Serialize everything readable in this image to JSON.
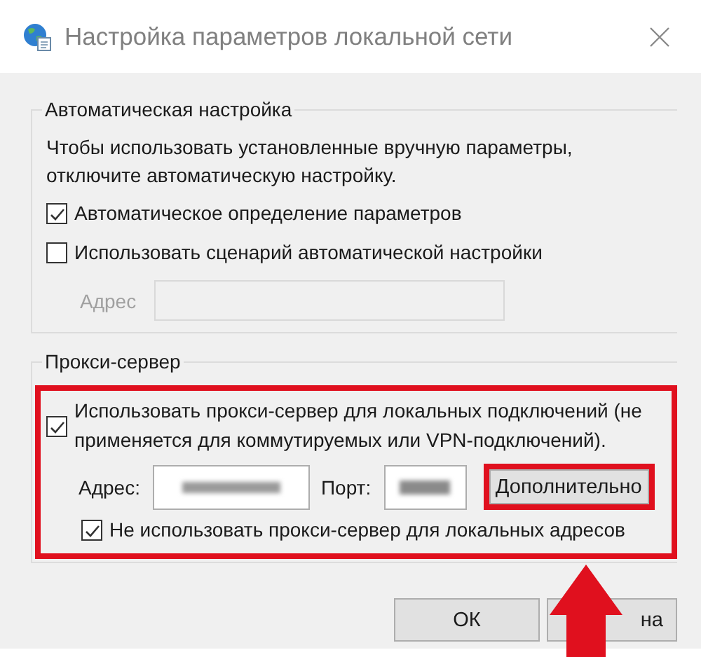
{
  "window": {
    "title": "Настройка параметров локальной сети"
  },
  "automatic": {
    "legend": "Автоматическая настройка",
    "hint": "Чтобы использовать установленные вручную параметры,\nотключите автоматическую настройку.",
    "options": [
      {
        "label": "Автоматическое определение параметров",
        "checked": true
      },
      {
        "label": "Использовать сценарий автоматической настройки",
        "checked": false
      }
    ],
    "script_address": {
      "label": "Адрес",
      "disabled": true
    }
  },
  "proxy": {
    "legend": "Прокси-сервер",
    "use_proxy": {
      "label": "Использовать прокси-сервер для локальных подключений (не\nприменяется для коммутируемых или VPN-подключений).",
      "checked": true
    },
    "address": {
      "label": "Адрес:"
    },
    "port": {
      "label": "Порт:"
    },
    "advanced_button": "Дополнительно",
    "bypass_local": {
      "label": "Не использовать прокси-сервер для локальных адресов",
      "checked": true
    }
  },
  "buttons": [
    {
      "label": "ОК"
    },
    {
      "label": "на"
    }
  ]
}
